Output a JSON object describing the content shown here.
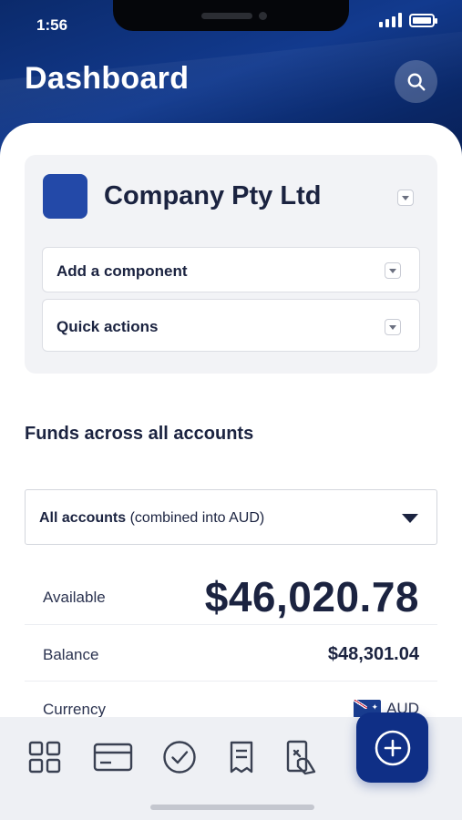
{
  "status_bar": {
    "time": "1:56"
  },
  "header": {
    "title": "Dashboard",
    "search_icon": "search-icon"
  },
  "company": {
    "name": "Company Pty Ltd",
    "logo_color": "#2349a8",
    "rows": [
      {
        "label": "Add a component"
      },
      {
        "label": "Quick actions"
      }
    ]
  },
  "funds": {
    "section_title": "Funds across all accounts",
    "select": {
      "selected_strong": "All accounts",
      "selected_note": "(combined into AUD)"
    },
    "available": {
      "label": "Available",
      "value": "$46,020.78"
    },
    "balance": {
      "label": "Balance",
      "value": "$48,301.04"
    },
    "currency": {
      "label": "Currency",
      "value": "AUD",
      "flag_icon": "australia-flag-icon"
    }
  },
  "bottom_nav": {
    "items": [
      {
        "icon": "dashboard-grid-icon"
      },
      {
        "icon": "card-icon"
      },
      {
        "icon": "approvals-check-icon"
      },
      {
        "icon": "receipt-icon"
      },
      {
        "icon": "payments-icon"
      }
    ],
    "fab_icon": "add-circle-icon"
  },
  "colors": {
    "brand_navy": "#0f2f86",
    "header_gradient_start": "#0b2a6b",
    "text_primary": "#1b2340",
    "card_background": "#f2f3f6",
    "nav_background": "#eef0f4"
  }
}
